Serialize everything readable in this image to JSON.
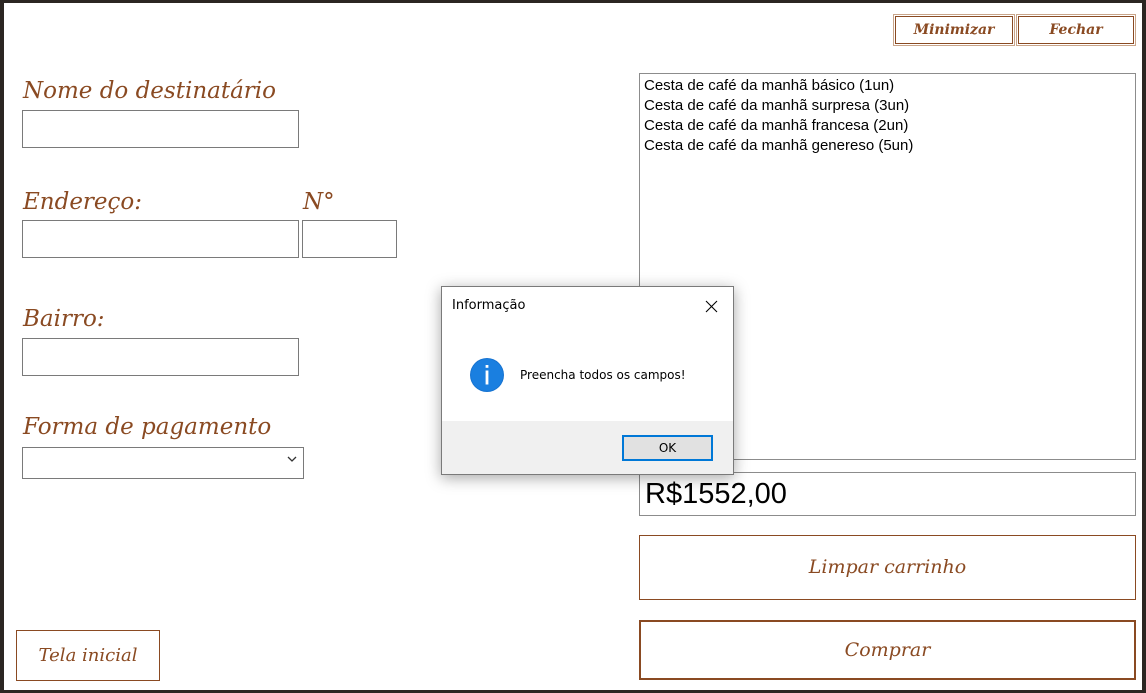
{
  "window": {
    "minimize_label": "Minimizar",
    "close_label": "Fechar"
  },
  "form": {
    "recipient_label": "Nome do destinatário",
    "recipient_value": "",
    "address_label": "Endereço:",
    "number_label": "N°",
    "address_value": "",
    "number_value": "",
    "district_label": "Bairro:",
    "district_value": "",
    "payment_label": "Forma de pagamento",
    "payment_selected": ""
  },
  "cart": {
    "items": [
      "Cesta de café da manhã básico (1un)",
      "Cesta de café da manhã surpresa (3un)",
      "Cesta de café da manhã francesa (2un)",
      "Cesta de café da manhã genereso (5un)"
    ],
    "total": "R$1552,00",
    "clear_label": "Limpar carrinho",
    "buy_label": "Comprar"
  },
  "nav": {
    "home_label": "Tela inicial"
  },
  "dialog": {
    "title": "Informação",
    "message": "Preencha todos os campos!",
    "ok_label": "OK",
    "icon": "info-icon"
  },
  "colors": {
    "accent": "#8a4a22",
    "dialog_accent": "#0078d7"
  }
}
